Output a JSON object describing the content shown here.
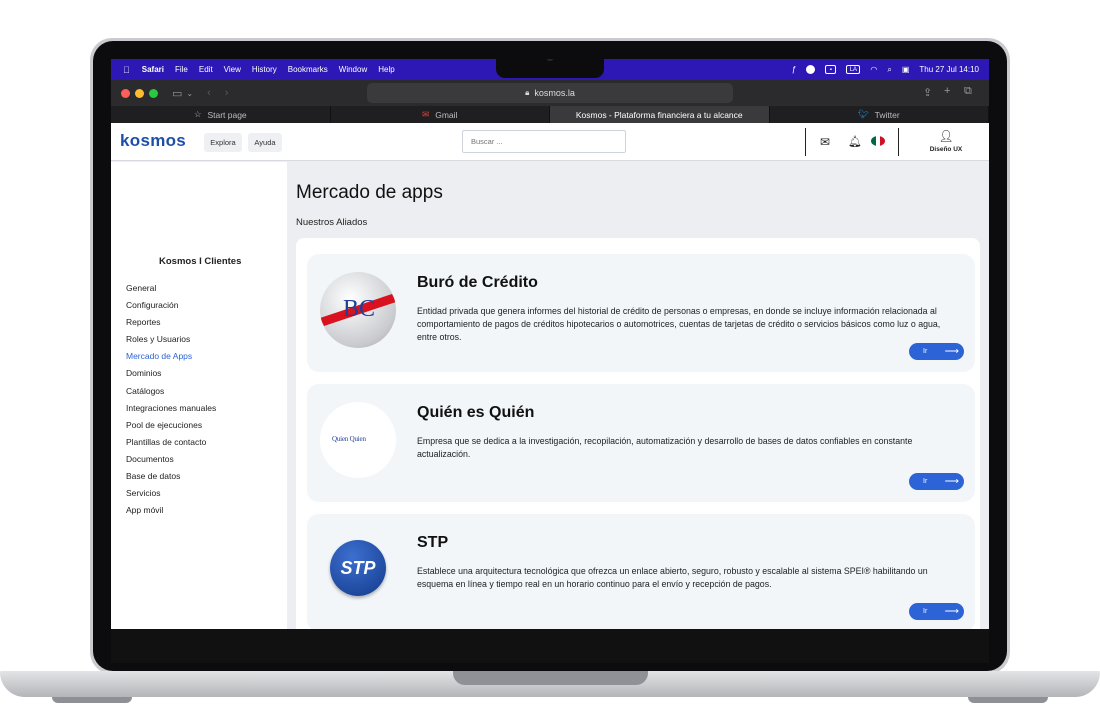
{
  "menubar": {
    "app": "Safari",
    "items": [
      "File",
      "Edit",
      "View",
      "History",
      "Bookmarks",
      "Window",
      "Help"
    ],
    "input_source": "LA",
    "clock": "Thu 27 Jul  14:10"
  },
  "browser": {
    "url": "kosmos.la",
    "tabs": [
      {
        "label": "Start page",
        "icon": "star-icon"
      },
      {
        "label": "Gmail",
        "icon": "gmail-icon"
      },
      {
        "label": "Kosmos - Plataforma financiera a tu alcance",
        "icon": ""
      },
      {
        "label": "Twitter",
        "icon": "twitter-icon"
      }
    ]
  },
  "header": {
    "logo": "kosmos",
    "nav": [
      "Explora",
      "Ayuda"
    ],
    "search_placeholder": "Buscar ...",
    "user_label": "Diseño UX"
  },
  "sidebar": {
    "title": "Kosmos I Clientes",
    "items": [
      {
        "label": "General"
      },
      {
        "label": "Configuración"
      },
      {
        "label": "Reportes"
      },
      {
        "label": "Roles y Usuarios"
      },
      {
        "label": "Mercado de Apps",
        "active": true
      },
      {
        "label": "Dominios"
      },
      {
        "label": "Catálogos"
      },
      {
        "label": "Integraciones manuales"
      },
      {
        "label": "Pool de ejecuciones"
      },
      {
        "label": "Plantillas de contacto"
      },
      {
        "label": "Documentos"
      },
      {
        "label": "Base de datos"
      },
      {
        "label": "Servicios"
      },
      {
        "label": "App móvil"
      }
    ]
  },
  "main": {
    "title": "Mercado de apps",
    "subtitle": "Nuestros Aliados",
    "cards": [
      {
        "name": "Buró de Crédito",
        "logo_text": "BC",
        "description": "Entidad privada que genera informes del historial de crédito de personas o empresas, en donde se incluye información relacionada al comportamiento de pagos de créditos hipotecarios o automotrices, cuentas de tarjetas de crédito o servicios básicos como luz o agua, entre otros.",
        "button": "Ir"
      },
      {
        "name": "Quién es Quién",
        "logo_text": "Quien Quien",
        "description": "Empresa que se dedica a la investigación, recopilación, automatización y desarrollo de  bases de datos confiables en constante actualización.",
        "button": "Ir"
      },
      {
        "name": "STP",
        "logo_text": "STP",
        "description": "Establece una arquitectura tecnológica que ofrezca un enlace abierto, seguro, robusto y escalable al sistema SPEI® habilitando un esquema en línea y tiempo real en un horario continuo para el envío y recepción de pagos.",
        "button": "Ir"
      }
    ]
  },
  "colors": {
    "menubar": "#2d18b5",
    "accent": "#2c63d6",
    "brand": "#1e4fa8"
  }
}
